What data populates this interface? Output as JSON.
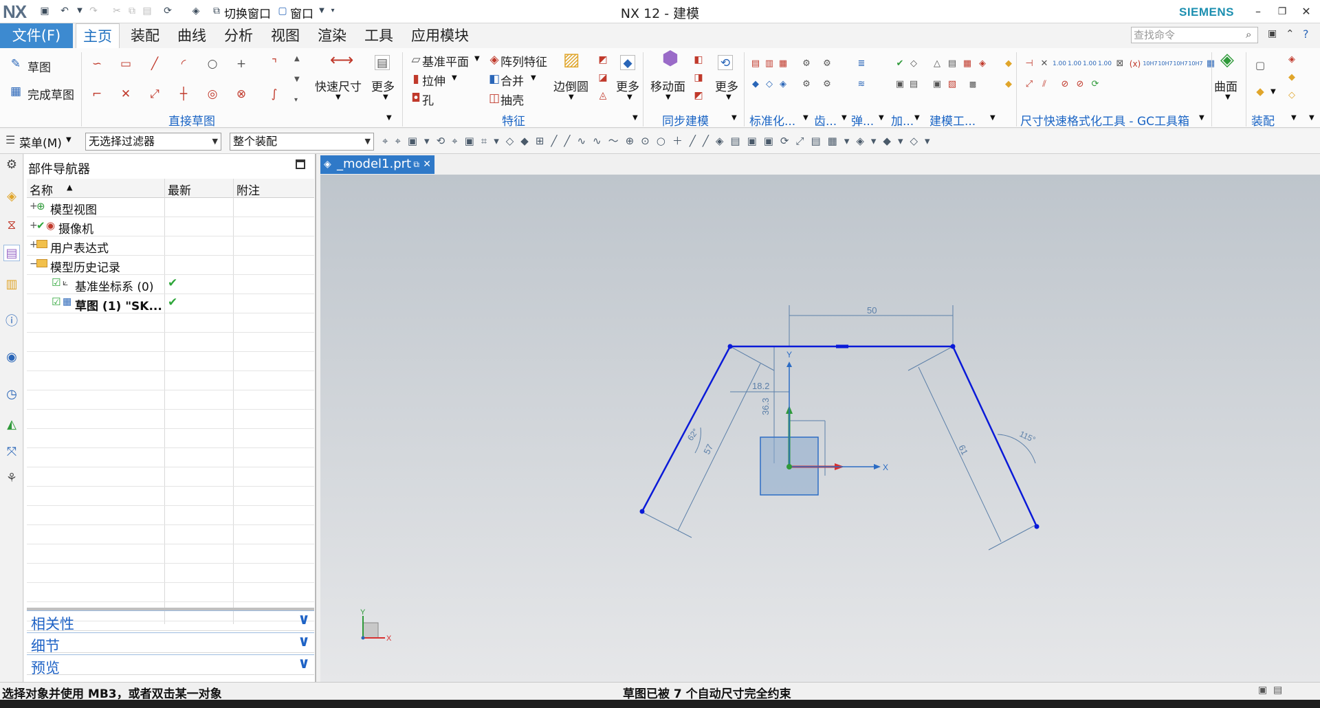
{
  "app": {
    "logo": "NX",
    "title": "NX 12 - 建模",
    "brand": "SIEMENS"
  },
  "menu": {
    "file": "文件(F)",
    "tabs": [
      "主页",
      "装配",
      "曲线",
      "分析",
      "视图",
      "渲染",
      "工具",
      "应用模块"
    ],
    "active_tab": "主页",
    "search_placeholder": "查找命令"
  },
  "quick_access": {
    "switch_window": "切换窗口",
    "window": "窗口"
  },
  "ribbon": {
    "sketch": "草图",
    "finish_sketch": "完成草图",
    "direct_sketch_group": "直接草图",
    "rapid_dimension": "快速尺寸",
    "more": "更多",
    "datum_plane": "基准平面",
    "pattern_feature": "阵列特征",
    "extrude": "拉伸",
    "unite": "合并",
    "hole": "孔",
    "shell": "抽壳",
    "edge_blend": "边倒圆",
    "feature_group": "特征",
    "move_face": "移动面",
    "sync_group": "同步建模",
    "standard_group": "标准化...",
    "gear_group": "齿...",
    "spring_group": "弹...",
    "add_group": "加...",
    "modeling_tools_group": "建模工...",
    "dim_format_group": "尺寸快速格式化工具 - GC工具箱",
    "surface": "曲面",
    "assembly_group": "装配"
  },
  "selection_bar": {
    "menu": "菜单(M)",
    "filter": "无选择过滤器",
    "scope": "整个装配"
  },
  "navigator": {
    "title": "部件导航器",
    "columns": [
      "名称",
      "最新",
      "附注"
    ],
    "rows": [
      {
        "label": "模型视图",
        "expander": "+",
        "latest": ""
      },
      {
        "label": "摄像机",
        "expander": "+",
        "latest": ""
      },
      {
        "label": "用户表达式",
        "expander": "+",
        "latest": ""
      },
      {
        "label": "模型历史记录",
        "expander": "−",
        "latest": ""
      },
      {
        "label": "基准坐标系 (0)",
        "expander": "",
        "latest": "✔"
      },
      {
        "label": "草图 (1) \"SK...",
        "expander": "",
        "latest": "✔"
      }
    ],
    "panels": [
      "相关性",
      "细节",
      "预览"
    ]
  },
  "viewport": {
    "tab_label": "_model1.prt",
    "dimensions": [
      "50",
      "18.2",
      "36.3",
      "57",
      "61",
      "62°",
      "115°"
    ],
    "axis_labels": [
      "X",
      "Y",
      "X",
      "Y"
    ]
  },
  "status": {
    "prompt": "选择对象并使用 MB3，或者双击某一对象",
    "message": "草图已被 7 个自动尺寸完全约束"
  },
  "colors": {
    "accent": "#3d8ad0",
    "sketch_line": "#0a1ad8",
    "dimension": "#5b7fa8"
  }
}
